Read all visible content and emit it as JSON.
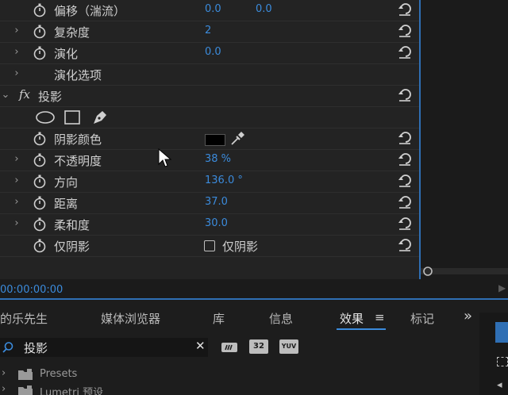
{
  "effect_controls": {
    "rows": [
      {
        "label": "偏移（湍流）",
        "value1": "0.0",
        "value2": "0.0"
      },
      {
        "label": "复杂度",
        "value1": "2"
      },
      {
        "label": "演化",
        "value1": "0.0"
      },
      {
        "label": "演化选项"
      },
      {
        "label": "投影",
        "fx": "fx"
      },
      {
        "label": "阴影颜色"
      },
      {
        "label": "不透明度",
        "value1": "38 %"
      },
      {
        "label": "方向",
        "value1": "136.0 °"
      },
      {
        "label": "距离",
        "value1": "37.0"
      },
      {
        "label": "柔和度",
        "value1": "30.0"
      },
      {
        "label": "仅阴影",
        "checkbox_label": "仅阴影",
        "checked": false
      }
    ],
    "shadow_color": "#000000"
  },
  "timeline": {
    "timecode": "00:00:00:00"
  },
  "panel_tabs": [
    "的乐先生",
    "媒体浏览器",
    "库",
    "信息",
    "效果",
    "标记"
  ],
  "active_tab": "效果",
  "overflow_label": "»",
  "search": {
    "value": "投影"
  },
  "badges": [
    "32",
    "YUV"
  ],
  "tree": [
    {
      "label": "Presets"
    },
    {
      "label": "Lumetri 预设"
    }
  ],
  "colors": {
    "accent": "#3b8bdc",
    "panel": "#232323",
    "active_border": "#2f6fb4"
  }
}
